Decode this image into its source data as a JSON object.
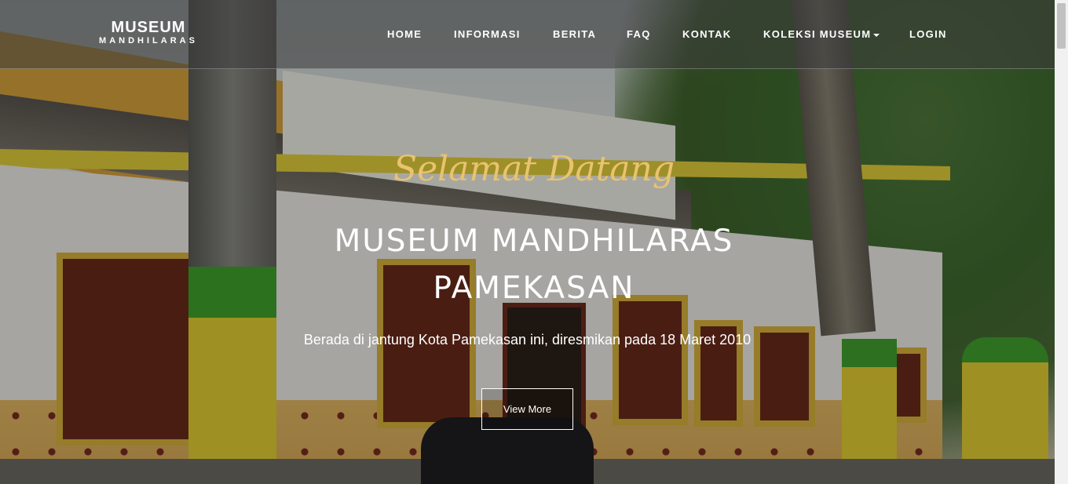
{
  "brand": {
    "line1": "MUSEUM",
    "line2": "MANDHILARAS"
  },
  "nav": {
    "home": "HOME",
    "informasi": "INFORMASI",
    "berita": "BERITA",
    "faq": "FAQ",
    "kontak": "KONTAK",
    "koleksi": "KOLEKSI MUSEUM",
    "login": "LOGIN"
  },
  "hero": {
    "script_title": "Selamat Datang",
    "title_line1": "MUSEUM MANDHILARAS",
    "title_line2": "PAMEKASAN",
    "subtitle": "Berada di jantung Kota Pamekasan ini, diresmikan pada 18 Maret 2010",
    "button": "View More"
  },
  "colors": {
    "accent_script": "#e9c36f",
    "nav_text": "#ffffff"
  }
}
